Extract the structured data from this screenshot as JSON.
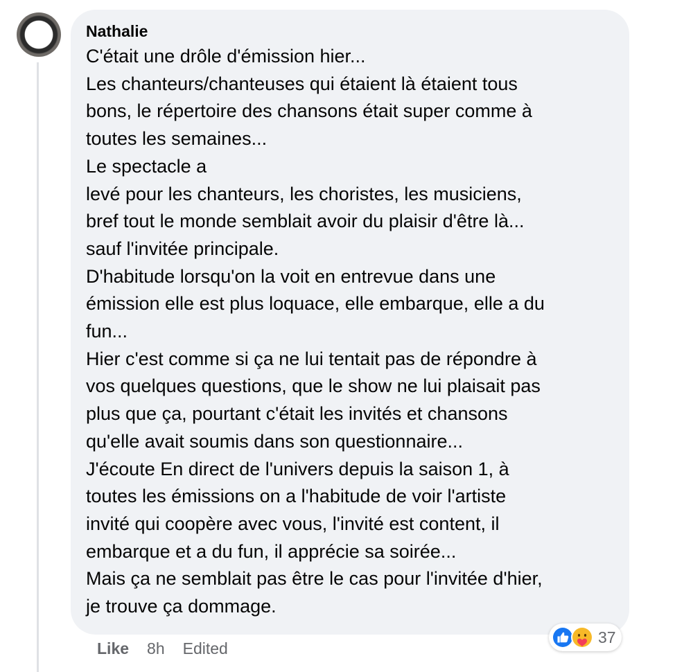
{
  "comment": {
    "author": "Nathalie",
    "lines": [
      "C'était une drôle d'émission hier...",
      "Les chanteurs/chanteuses qui étaient là étaient tous",
      "bons, le répertoire des chansons était super comme à",
      "toutes les semaines...",
      "Le spectacle a",
      "levé pour les chanteurs, les choristes, les musiciens,",
      "bref tout le monde semblait avoir du plaisir d'être là...",
      "sauf l'invitée principale.",
      "D'habitude lorsqu'on la voit en entrevue dans une",
      "émission elle est plus loquace, elle embarque, elle a du",
      "fun...",
      "Hier c'est comme si ça ne lui tentait pas de répondre à",
      "vos quelques questions, que le show ne lui plaisait pas",
      "plus que ça, pourtant c'était les invités et chansons",
      "qu'elle avait soumis dans son questionnaire...",
      "J'écoute En direct de l'univers depuis la saison 1, à",
      "toutes les émissions on a l'habitude de voir l'artiste",
      "invité qui coopère avec vous, l'invité est content, il",
      "embarque et a du fun, il apprécie sa soirée...",
      "Mais ça ne semblait pas être le cas pour l'invitée d'hier,",
      "je trouve ça dommage."
    ]
  },
  "actions": {
    "like_label": "Like",
    "time": "8h",
    "edited_label": "Edited"
  },
  "reactions": {
    "icons": [
      "like-icon",
      "care-icon"
    ],
    "count": "37"
  },
  "colors": {
    "bubble": "#f0f2f5",
    "text": "#050505",
    "secondary_text": "#65676b",
    "like_blue": "#1877f2",
    "care_yellow": "#f7b928",
    "care_red": "#f33e58"
  }
}
